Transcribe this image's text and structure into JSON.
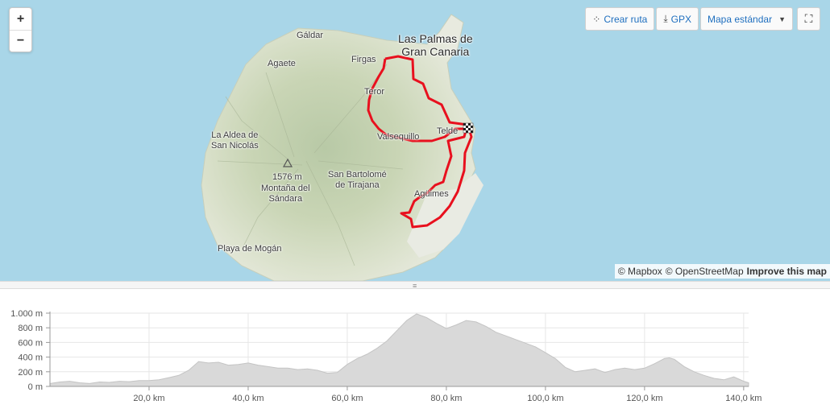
{
  "map": {
    "zoom_in": "+",
    "zoom_out": "−",
    "places": {
      "galdar": "Gáldar",
      "agaete": "Agaete",
      "firgas": "Firgas",
      "las_palmas": "Las Palmas de\nGran Canaria",
      "teror": "Teror",
      "telde": "Telde",
      "la_aldea": "La Aldea de\nSan Nicolás",
      "valsequillo": "Valsequillo",
      "peak_elev": "1576 m",
      "peak_name": "Montaña del\nSándara",
      "san_bartolome": "San Bartolomé\nde Tirajana",
      "aguimes": "Agüimes",
      "playa_mogan": "Playa de Mogán"
    },
    "toolbar": {
      "create_route": "Crear ruta",
      "gpx": "GPX",
      "map_style": "Mapa estándar"
    },
    "icons": {
      "create_route": "route-dots-icon",
      "gpx": "download-icon",
      "map_style": "caret-down-icon",
      "fullscreen": "expand-icon",
      "finish": "checkered-flag-icon",
      "peak": "triangle-peak-icon"
    },
    "attribution": {
      "mapbox": "© Mapbox",
      "osm": "© OpenStreetMap",
      "improve": "Improve this map"
    },
    "colors": {
      "water": "#a9d6e8",
      "route": "#e8101e"
    }
  },
  "chart_data": {
    "type": "area",
    "xlabel": "",
    "ylabel": "",
    "x_unit": "km",
    "x_ticks": [
      "20,0 km",
      "40,0 km",
      "60,0 km",
      "80,0 km",
      "100,0 km",
      "120,0 km",
      "140,0 km"
    ],
    "x_tick_values": [
      20,
      40,
      60,
      80,
      100,
      120,
      140
    ],
    "y_ticks": [
      "0 m",
      "200 m",
      "400 m",
      "600 m",
      "800 m",
      "1.000 m"
    ],
    "y_tick_values": [
      0,
      200,
      400,
      600,
      800,
      1000
    ],
    "xlim": [
      0,
      141
    ],
    "ylim": [
      0,
      1000
    ],
    "grid": true,
    "fill_color": "#d9d9d9",
    "x": [
      0,
      2,
      4,
      6,
      8,
      10,
      12,
      14,
      16,
      18,
      20,
      22,
      24,
      26,
      28,
      30,
      32,
      34,
      36,
      38,
      40,
      42,
      44,
      46,
      48,
      50,
      52,
      54,
      56,
      58,
      60,
      62,
      64,
      66,
      68,
      70,
      72,
      74,
      76,
      78,
      80,
      82,
      84,
      86,
      88,
      90,
      92,
      94,
      96,
      98,
      100,
      102,
      104,
      106,
      108,
      110,
      112,
      114,
      116,
      118,
      120,
      122,
      124,
      125,
      126,
      128,
      130,
      132,
      134,
      136,
      138,
      140,
      141
    ],
    "y": [
      40,
      60,
      70,
      50,
      40,
      60,
      55,
      70,
      65,
      80,
      80,
      90,
      120,
      150,
      220,
      340,
      320,
      330,
      290,
      300,
      320,
      290,
      270,
      250,
      250,
      230,
      240,
      220,
      180,
      190,
      300,
      380,
      440,
      520,
      620,
      760,
      900,
      990,
      940,
      860,
      790,
      840,
      900,
      880,
      820,
      740,
      690,
      640,
      590,
      540,
      460,
      380,
      260,
      200,
      220,
      240,
      190,
      230,
      250,
      230,
      250,
      310,
      380,
      390,
      370,
      270,
      200,
      150,
      110,
      90,
      130,
      70,
      50
    ]
  }
}
